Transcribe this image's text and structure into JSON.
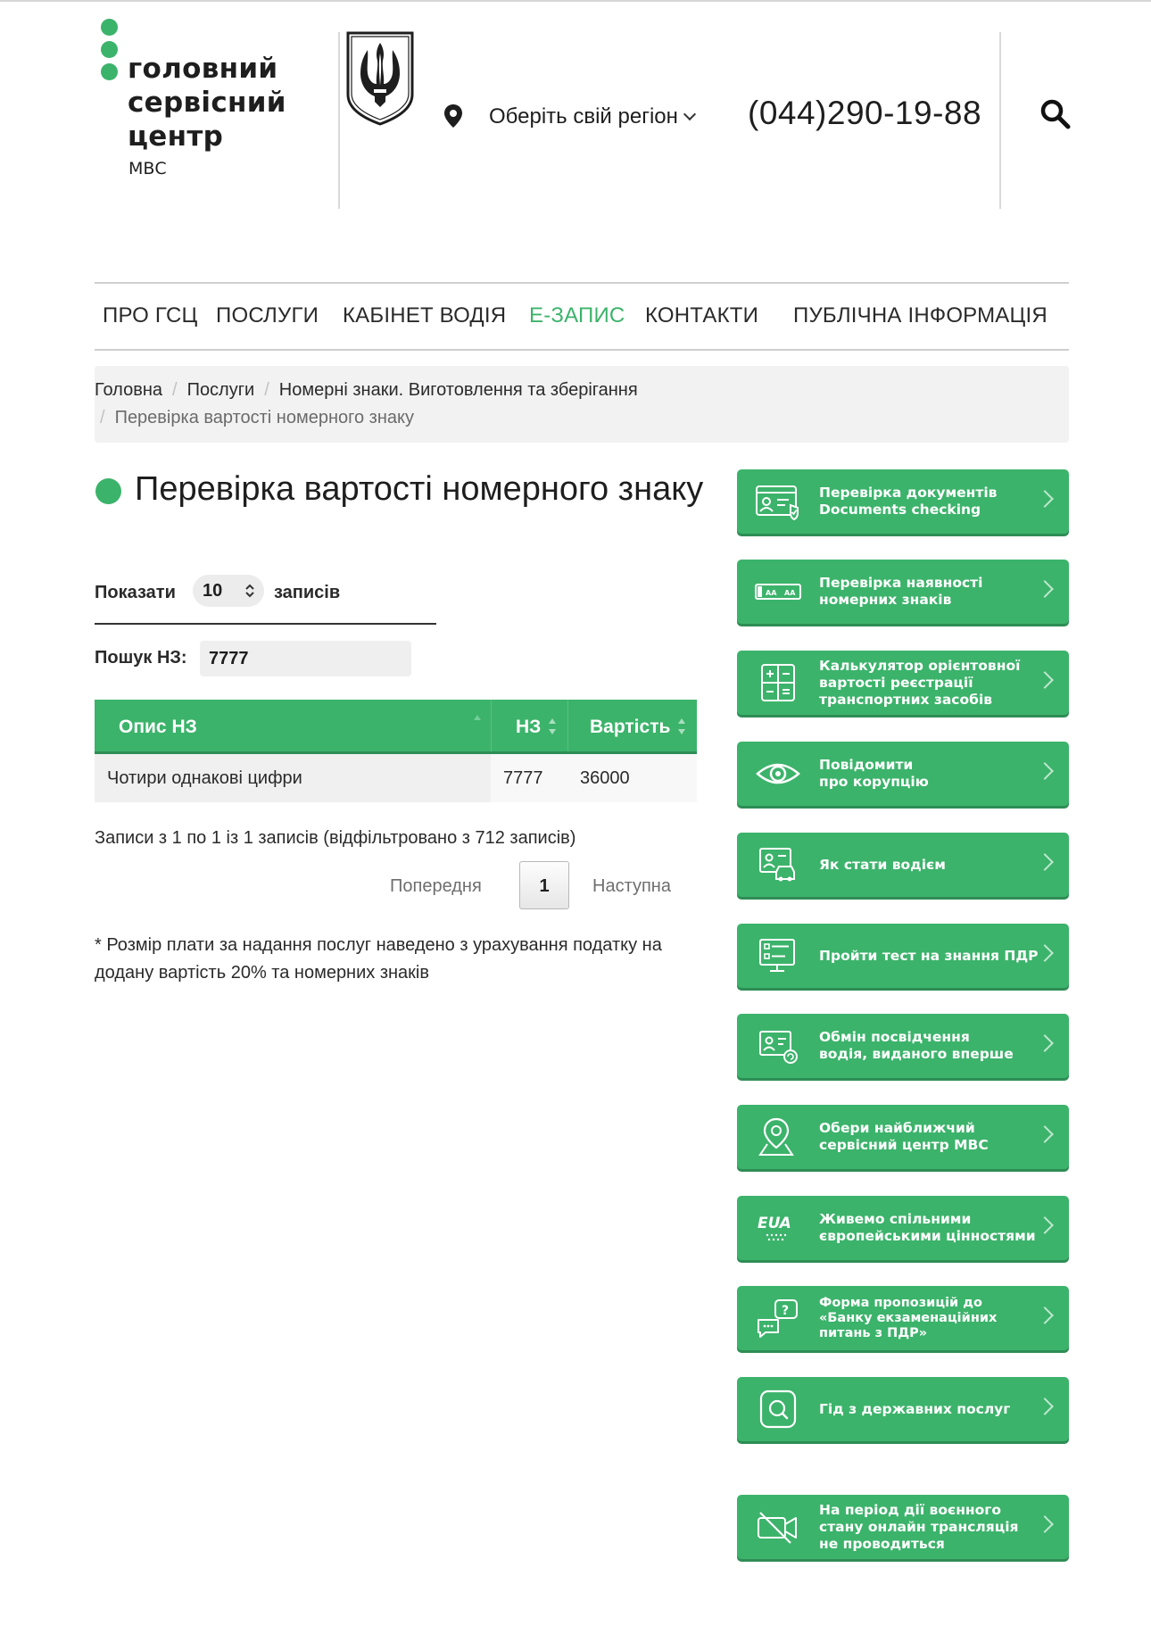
{
  "header": {
    "logo_lines": [
      "головний",
      "сервісний",
      "центр"
    ],
    "logo_sub": "МВС",
    "region_label": "Оберіть свій регіон",
    "phone": "(044)290-19-88"
  },
  "nav": {
    "items": [
      {
        "label": "ПРО ГСЦ"
      },
      {
        "label": "ПОСЛУГИ"
      },
      {
        "label": "КАБІНЕТ ВОДІЯ"
      },
      {
        "label": "Е-ЗАПИС"
      },
      {
        "label": "КОНТАКТИ"
      },
      {
        "label": "ПУБЛІЧНА ІНФОРМАЦІЯ"
      }
    ],
    "active_index": 3
  },
  "breadcrumb": {
    "items": [
      "Головна",
      "Послуги",
      "Номерні знаки. Виготовлення та зберігання"
    ],
    "current": "Перевірка вартості номерного знаку"
  },
  "page": {
    "title": "Перевірка вартості номерного знаку",
    "show_label": "Показати",
    "show_value": "10",
    "show_suffix": "записів",
    "search_label": "Пошук НЗ:",
    "search_value": "7777"
  },
  "table": {
    "headers": [
      "Опис НЗ",
      "НЗ",
      "Вартість"
    ],
    "rows": [
      [
        "Чотири однакові цифри",
        "7777",
        "36000"
      ]
    ],
    "info": "Записи з 1 по 1 із 1 записів (відфільтровано з 712 записів)",
    "prev_label": "Попередня",
    "current_page": "1",
    "next_label": "Наступна"
  },
  "footnote": "* Розмір плати за надання послуг наведено з урахування податку на додану вартість 20% та номерних знаків",
  "sidebar": {
    "items": [
      {
        "lines": [
          "Перевірка документів",
          "Documents checking"
        ],
        "icon": "id-card-check-icon"
      },
      {
        "lines": [
          "Перевірка наявності",
          "номерних знаків"
        ],
        "icon": "license-plate-icon"
      },
      {
        "lines": [
          "Калькулятор орієнтовної",
          "вартості реєстрації",
          "транспортних засобів"
        ],
        "icon": "calculator-icon"
      },
      {
        "lines": [
          "Повідомити",
          "про корупцію"
        ],
        "icon": "eye-icon"
      },
      {
        "lines": [
          "Як стати водієм"
        ],
        "icon": "driver-license-icon"
      },
      {
        "lines": [
          "Пройти тест на знання ПДР"
        ],
        "icon": "monitor-test-icon"
      },
      {
        "lines": [
          "Обмін посвідчення",
          "водія, виданого вперше"
        ],
        "icon": "license-exchange-icon"
      },
      {
        "lines": [
          "Обери найближчий",
          "сервісний центр МВС"
        ],
        "icon": "map-pin-icon"
      },
      {
        "lines": [
          "Живемо спільними",
          "європейськими цінностями"
        ],
        "icon": "eu-ua-icon"
      },
      {
        "lines": [
          "Форма пропозицій до",
          "«Банку екзаменаційних",
          "питань з ПДР»"
        ],
        "icon": "chat-question-icon"
      },
      {
        "lines": [
          "Гід з державних послуг"
        ],
        "icon": "guide-search-icon"
      },
      {
        "lines": [
          "На період дії воєнного",
          "стану онлайн трансляція",
          "не проводиться"
        ],
        "icon": "camera-off-icon"
      }
    ]
  },
  "colors": {
    "accent": "#3cb36b",
    "accent_dark": "#2e8d55",
    "text": "#1e1e1e"
  }
}
